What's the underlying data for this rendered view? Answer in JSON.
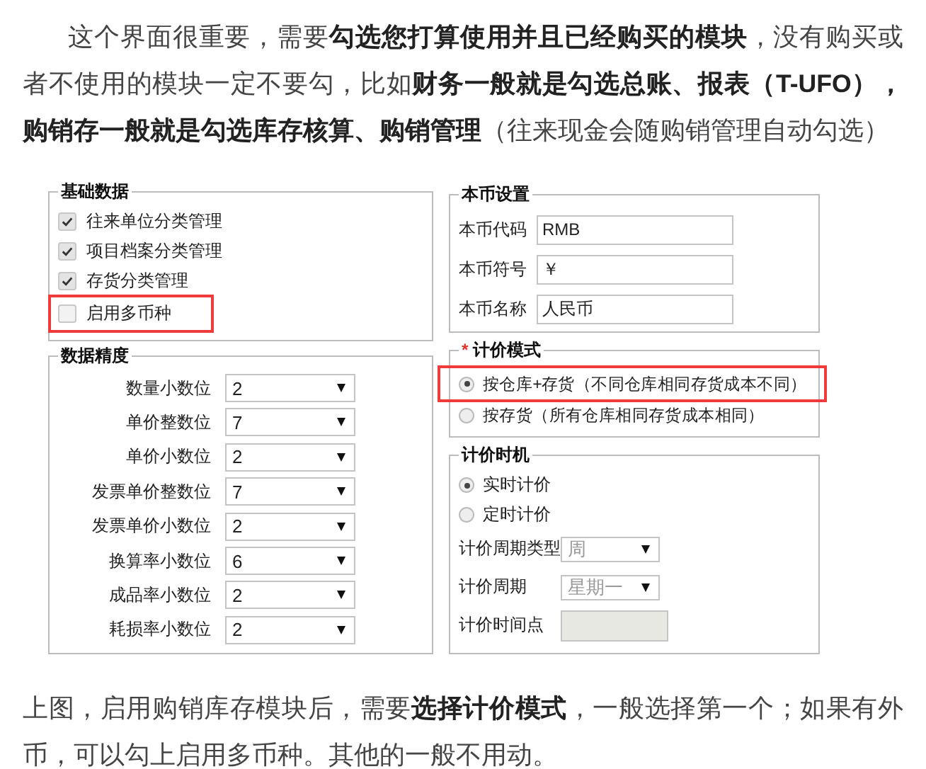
{
  "intro": "这个界面很重要，需要**勾选您打算使用并且已经购买的模块**，没有购买或者不使用的模块一定不要勾，比如**财务一般就是勾选总账、报表（T-UFO），购销存一般就是勾选库存核算、购销管理**（往来现金会随购销管理自动勾选）",
  "screenshot": {
    "base_data": {
      "title": "基础数据",
      "items": [
        {
          "label": "往来单位分类管理",
          "checked": true,
          "highlighted": false
        },
        {
          "label": "项目档案分类管理",
          "checked": true,
          "highlighted": false
        },
        {
          "label": "存货分类管理",
          "checked": true,
          "highlighted": false
        },
        {
          "label": "启用多币种",
          "checked": false,
          "highlighted": true
        }
      ]
    },
    "precision": {
      "title": "数据精度",
      "rows": [
        {
          "label": "数量小数位",
          "value": "2"
        },
        {
          "label": "单价整数位",
          "value": "7"
        },
        {
          "label": "单价小数位",
          "value": "2"
        },
        {
          "label": "发票单价整数位",
          "value": "7"
        },
        {
          "label": "发票单价小数位",
          "value": "2"
        },
        {
          "label": "换算率小数位",
          "value": "6"
        },
        {
          "label": "成品率小数位",
          "value": "2"
        },
        {
          "label": "耗损率小数位",
          "value": "2"
        }
      ]
    },
    "currency": {
      "title": "本币设置",
      "fields": [
        {
          "label": "本币代码",
          "value": "RMB"
        },
        {
          "label": "本币符号",
          "value": "￥"
        },
        {
          "label": "本币名称",
          "value": "人民币"
        }
      ]
    },
    "pricing_mode": {
      "required_mark": "*",
      "title": "计价模式",
      "options": [
        {
          "label": "按仓库+存货（不同仓库相同存货成本不同）",
          "selected": true,
          "highlighted": true
        },
        {
          "label": "按存货（所有仓库相同存货成本相同）",
          "selected": false,
          "highlighted": false
        }
      ]
    },
    "pricing_timing": {
      "title": "计价时机",
      "options": [
        {
          "label": "实时计价",
          "selected": true
        },
        {
          "label": "定时计价",
          "selected": false
        }
      ],
      "fields": [
        {
          "kind": "select",
          "label": "计价周期类型",
          "value": "周",
          "disabled": true
        },
        {
          "kind": "select",
          "label": "计价周期",
          "value": "星期一",
          "disabled": true
        },
        {
          "kind": "text",
          "label": "计价时间点",
          "disabled": true
        }
      ]
    }
  },
  "outro": "上图，启用购销库存模块后，需要**选择计价模式**，一般选择第一个；如果有外币，可以勾上启用多币种。其他的一般不用动。"
}
